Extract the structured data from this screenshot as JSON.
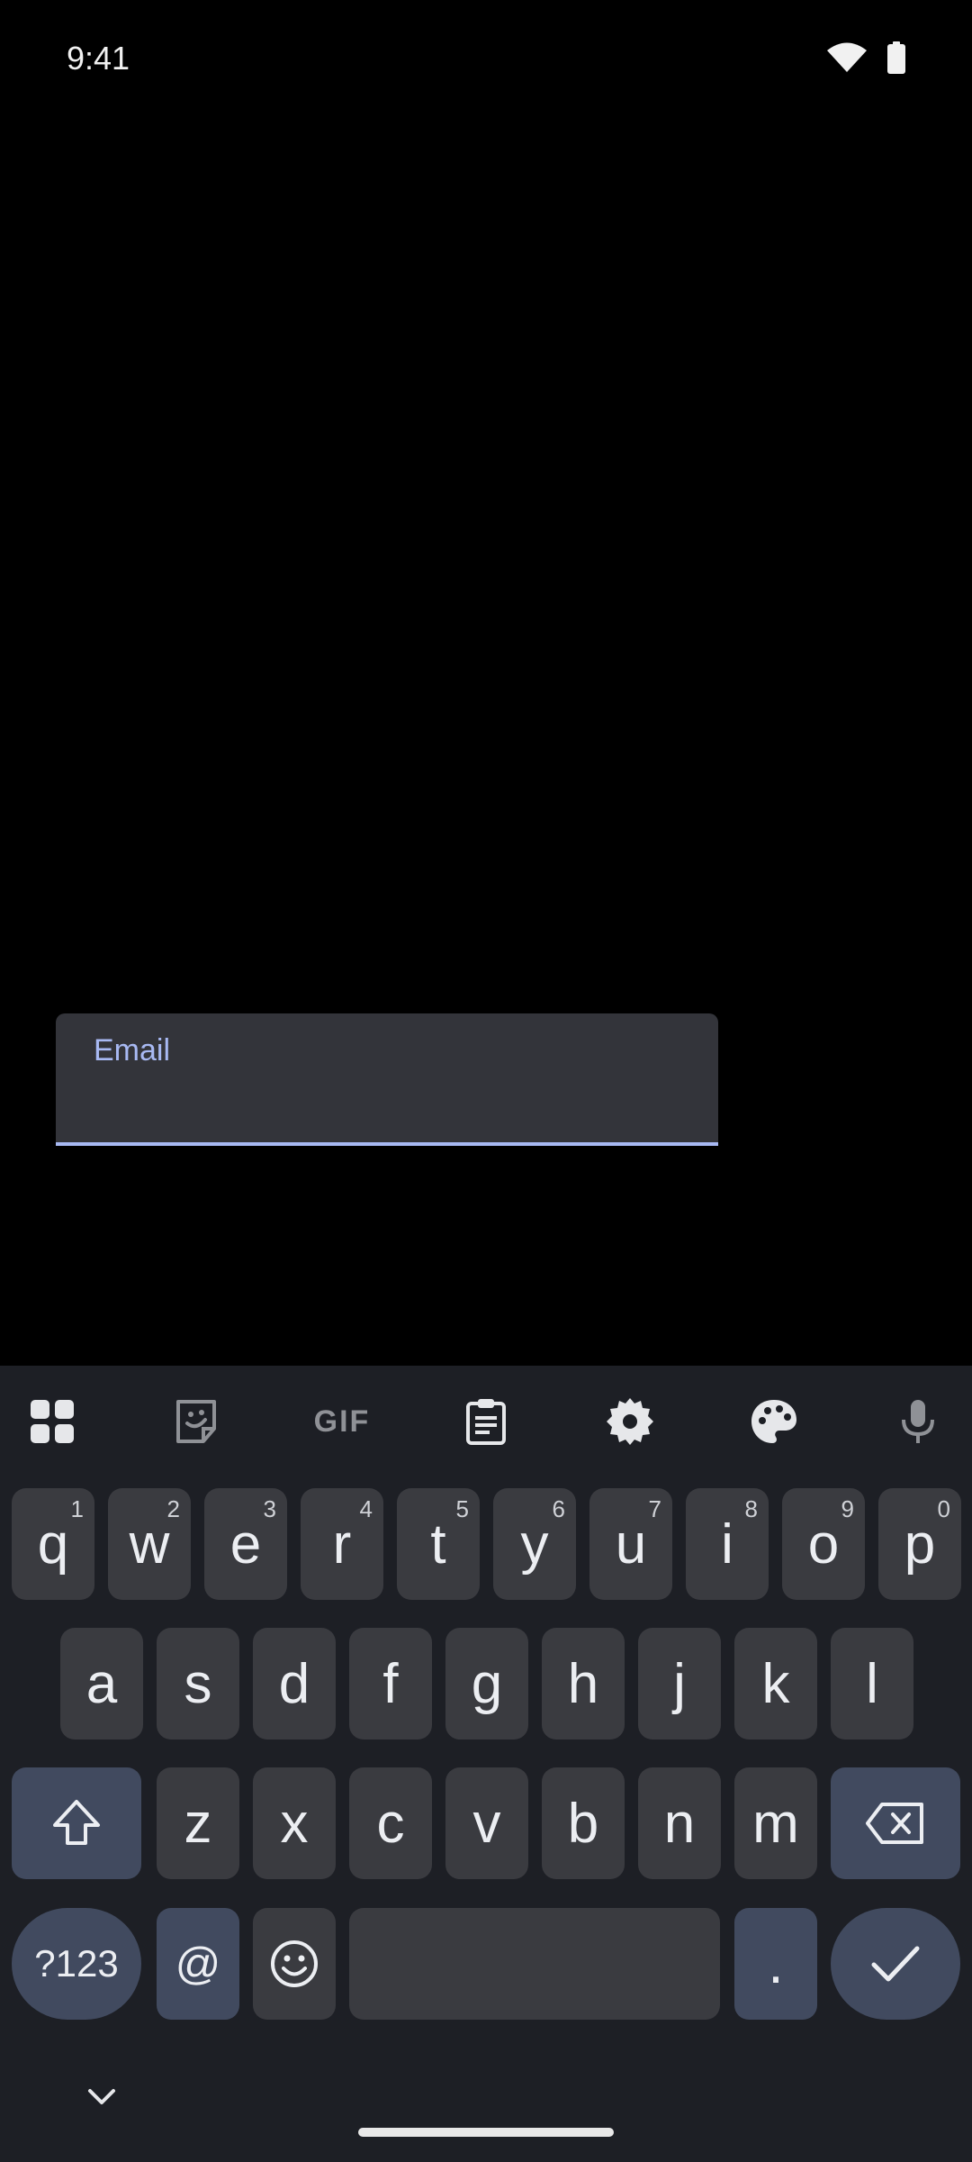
{
  "status_bar": {
    "time": "9:41"
  },
  "email_field": {
    "label": "Email",
    "value": "",
    "accent_color": "#a8b9f3"
  },
  "keyboard": {
    "toolbar": [
      "apps-grid-icon",
      "sticker-icon",
      "gif-icon",
      "clipboard-icon",
      "settings-icon",
      "palette-icon",
      "mic-icon"
    ],
    "toolbar_gif_label": "GIF",
    "row1": [
      {
        "key": "q",
        "hint": "1"
      },
      {
        "key": "w",
        "hint": "2"
      },
      {
        "key": "e",
        "hint": "3"
      },
      {
        "key": "r",
        "hint": "4"
      },
      {
        "key": "t",
        "hint": "5"
      },
      {
        "key": "y",
        "hint": "6"
      },
      {
        "key": "u",
        "hint": "7"
      },
      {
        "key": "i",
        "hint": "8"
      },
      {
        "key": "o",
        "hint": "9"
      },
      {
        "key": "p",
        "hint": "0"
      }
    ],
    "row2": [
      "a",
      "s",
      "d",
      "f",
      "g",
      "h",
      "j",
      "k",
      "l"
    ],
    "row3": [
      "z",
      "x",
      "c",
      "v",
      "b",
      "n",
      "m"
    ],
    "symbols_label": "?123",
    "at_label": "@",
    "period_label": "."
  }
}
